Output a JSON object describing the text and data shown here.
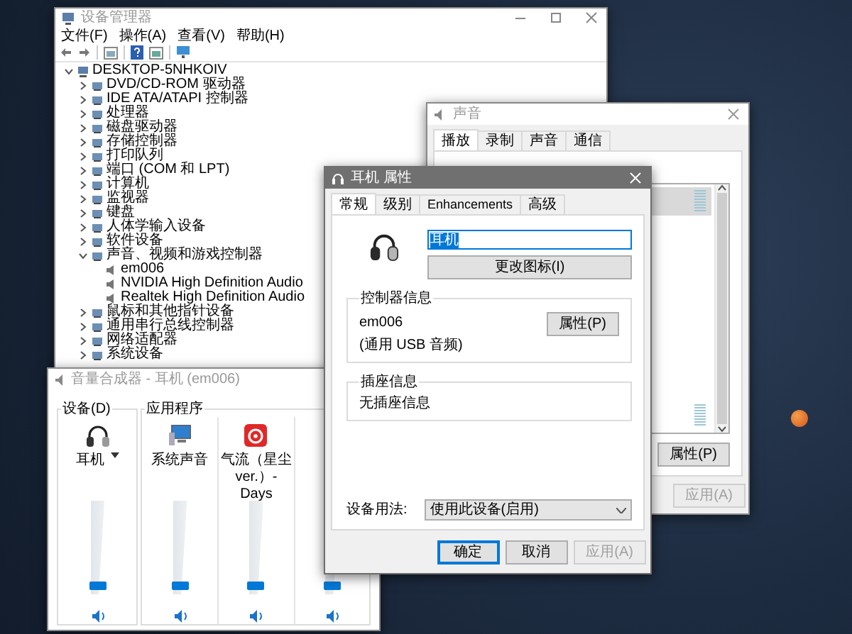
{
  "device_manager": {
    "title": "设备管理器",
    "menu": [
      "文件(F)",
      "操作(A)",
      "查看(V)",
      "帮助(H)"
    ],
    "tree": [
      {
        "label": "DESKTOP-5NHKOIV",
        "expanded": true,
        "children": [
          {
            "label": "DVD/CD-ROM 驱动器",
            "expanded": false
          },
          {
            "label": "IDE ATA/ATAPI 控制器",
            "expanded": false
          },
          {
            "label": "处理器",
            "expanded": false
          },
          {
            "label": "磁盘驱动器",
            "expanded": false
          },
          {
            "label": "存储控制器",
            "expanded": false
          },
          {
            "label": "打印队列",
            "expanded": false
          },
          {
            "label": "端口 (COM 和 LPT)",
            "expanded": false
          },
          {
            "label": "计算机",
            "expanded": false
          },
          {
            "label": "监视器",
            "expanded": false
          },
          {
            "label": "键盘",
            "expanded": false
          },
          {
            "label": "人体学输入设备",
            "expanded": false
          },
          {
            "label": "软件设备",
            "expanded": false
          },
          {
            "label": "声音、视频和游戏控制器",
            "expanded": true,
            "children": [
              {
                "label": "em006"
              },
              {
                "label": "NVIDIA High Definition Audio"
              },
              {
                "label": "Realtek High Definition Audio"
              }
            ]
          },
          {
            "label": "鼠标和其他指针设备",
            "expanded": false
          },
          {
            "label": "通用串行总线控制器",
            "expanded": false
          },
          {
            "label": "网络适配器",
            "expanded": false
          },
          {
            "label": "系统设备",
            "expanded": false
          }
        ]
      }
    ]
  },
  "sound": {
    "title": "声音",
    "tabs": [
      {
        "label": "播放",
        "selected": true
      },
      {
        "label": "录制",
        "selected": false
      },
      {
        "label": "声音",
        "selected": false
      },
      {
        "label": "通信",
        "selected": false
      }
    ],
    "devices": [
      {
        "selected": true
      },
      {
        "selected": false
      }
    ],
    "properties_button": "属性(P)",
    "footer_buttons": [
      {
        "label": "应用(A)",
        "disabled": true
      }
    ]
  },
  "properties": {
    "title": "耳机 属性",
    "tabs": [
      {
        "label": "常规",
        "selected": true
      },
      {
        "label": "级别",
        "selected": false
      },
      {
        "label": "Enhancements",
        "selected": false
      },
      {
        "label": "高级",
        "selected": false
      }
    ],
    "name": "耳机",
    "change_icon_button": "更改图标(I)",
    "controller": {
      "heading": "控制器信息",
      "name": "em006",
      "type": "(通用 USB 音频)",
      "button": "属性(P)"
    },
    "jack": {
      "heading": "插座信息",
      "text": "无插座信息"
    },
    "usage": {
      "label": "设备用法:",
      "value": "使用此设备(启用)"
    },
    "buttons": [
      {
        "label": "确定",
        "default": true,
        "disabled": false
      },
      {
        "label": "取消",
        "default": false,
        "disabled": false
      },
      {
        "label": "应用(A)",
        "default": false,
        "disabled": true
      }
    ]
  },
  "mixer": {
    "title": "音量合成器 - 耳机 (em006)",
    "device_group": "设备(D)",
    "device": {
      "name": "耳机",
      "level": 0.05
    },
    "apps_group": "应用程序",
    "apps": [
      {
        "kind": "system",
        "name": "系统声音",
        "level": 0.05
      },
      {
        "kind": "player",
        "name": "气流（星尘ver.）- Days",
        "level": 0.05
      },
      {
        "kind": "other",
        "level": 0.05
      }
    ]
  }
}
